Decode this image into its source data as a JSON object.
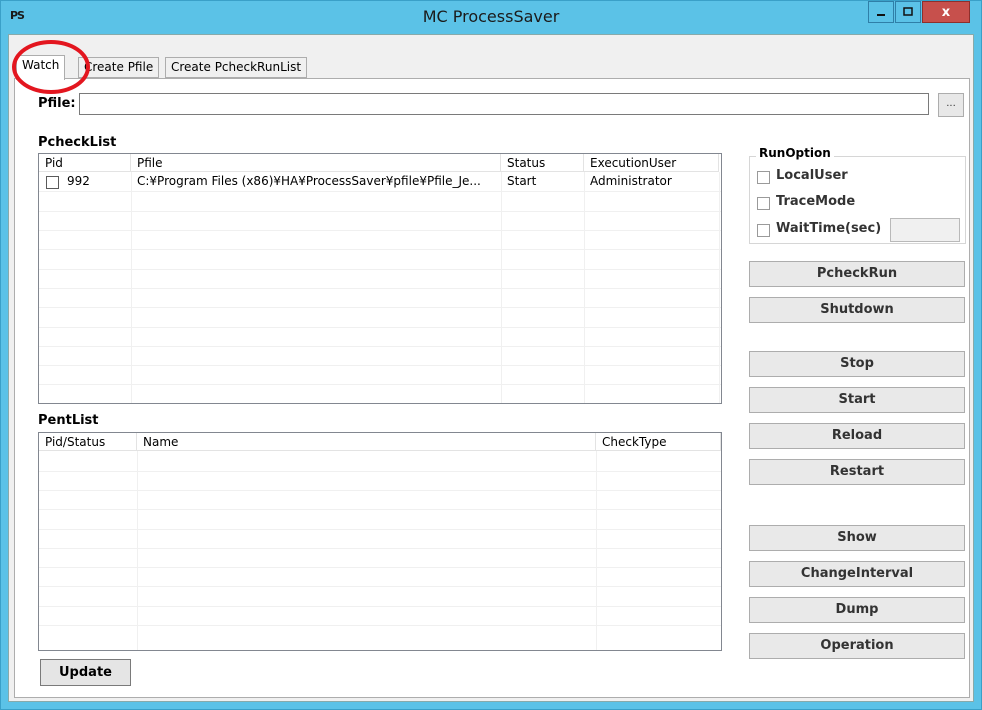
{
  "window": {
    "app_icon": "PS",
    "title": "MC ProcessSaver",
    "close_label": "x",
    "minimize_icon": "minimize-icon",
    "maximize_icon": "maximize-icon"
  },
  "tabs": [
    {
      "label": "Watch",
      "selected": true
    },
    {
      "label": "Create Pfile"
    },
    {
      "label": "Create PcheckRunList"
    }
  ],
  "pfile": {
    "label": "Pfile:",
    "value": "",
    "browse_label": "..."
  },
  "pchecklist": {
    "title": "PcheckList",
    "columns": [
      "Pid",
      "Pfile",
      "Status",
      "ExecutionUser"
    ],
    "rows": [
      {
        "checked": false,
        "pid": "992",
        "pfile": "C:¥Program Files (x86)¥HA¥ProcessSaver¥pfile¥Pfile_Je...",
        "status": "Start",
        "user": "Administrator"
      }
    ]
  },
  "pentlist": {
    "title": "PentList",
    "columns": [
      "Pid/Status",
      "Name",
      "CheckType"
    ],
    "rows": []
  },
  "runoption": {
    "title": "RunOption",
    "options": [
      {
        "label": "LocalUser",
        "checked": false
      },
      {
        "label": "TraceMode",
        "checked": false
      },
      {
        "label": "WaitTime(sec)",
        "checked": false
      }
    ],
    "waittime_value": ""
  },
  "buttons": {
    "pcheckrun": "PcheckRun",
    "shutdown": "Shutdown",
    "stop": "Stop",
    "start": "Start",
    "reload": "Reload",
    "restart": "Restart",
    "show": "Show",
    "changeinterval": "ChangeInterval",
    "dump": "Dump",
    "operation": "Operation",
    "update": "Update"
  },
  "colors": {
    "title_bar": "#5bc2e7",
    "close_button": "#c7504c",
    "annotation_circle": "#e3161f"
  }
}
